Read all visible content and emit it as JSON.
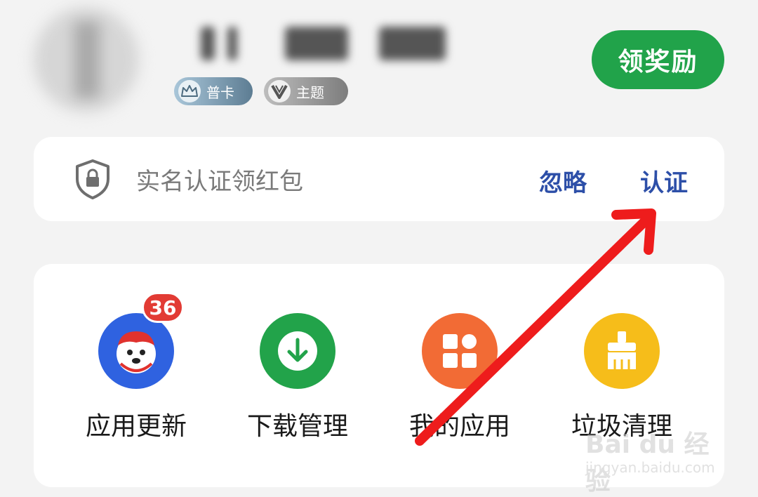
{
  "header": {
    "badges": [
      {
        "label": "普卡",
        "icon": "crown-icon"
      },
      {
        "label": "主题",
        "icon": "v-logo-icon"
      }
    ],
    "reward_button": "领奖励"
  },
  "verify": {
    "text": "实名认证领红包",
    "ignore": "忽略",
    "authenticate": "认证"
  },
  "apps": [
    {
      "label": "应用更新",
      "icon": "mascot-icon",
      "color": "#2f62e0",
      "badge": "36"
    },
    {
      "label": "下载管理",
      "icon": "download-icon",
      "color": "#22a34a"
    },
    {
      "label": "我的应用",
      "icon": "grid-apps-icon",
      "color": "#f26b35"
    },
    {
      "label": "垃圾清理",
      "icon": "broom-icon",
      "color": "#f6bd1a"
    }
  ],
  "watermark": {
    "brand": "Bai du 经验",
    "url": "jingyan.baidu.com"
  },
  "colors": {
    "accent_green": "#21a34a",
    "link_blue": "#2d4fa8",
    "annotation_red": "#ee1c1c"
  }
}
